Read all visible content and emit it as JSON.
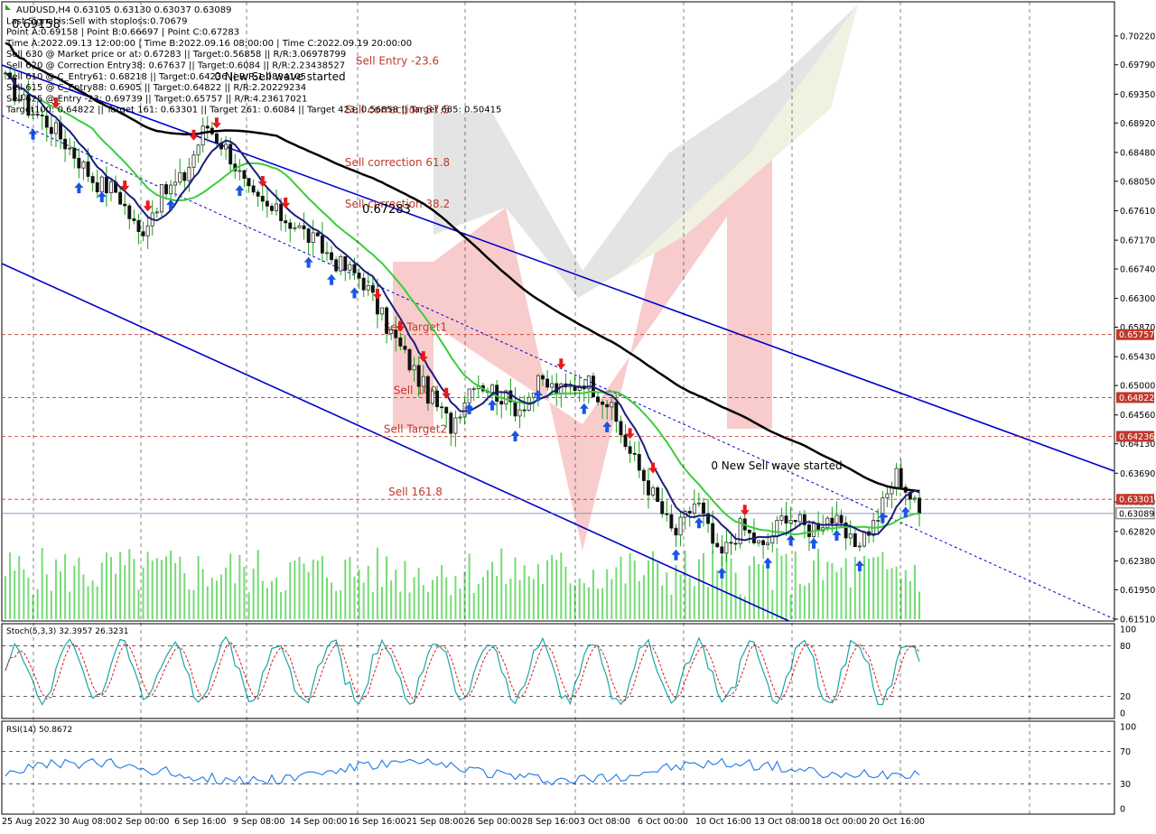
{
  "header": {
    "lines": [
      "AUDUSD,H4  0.63105 0.63130 0.63037 0.63089",
      "Last Signal is:Sell with stoploss:0.70679",
      "Point A:0.69158 | Point B:0.66697 | Point C:0.67283",
      "Time A:2022.09.13 12:00:00 | Time B:2022.09.16 08:00:00 | Time C:2022.09.19 20:00:00",
      "Sell 630 @ Market price or at: 0.67283 || Target:0.56858 || R/R:3.06978799",
      "Sell 620 @ Correction Entry38: 0.67637 || Target:0.6084 || R/R:2.23438527",
      "Sell 610 @ C_Entry61: 0.68218 || Target:0.64236 || R/R:1.0894105",
      "Sell 615 @ C_Entry88: 0.6905 || Target:0.64822 || R/R:2.20229234",
      "Sell 625 @ Entry -23: 0.69739 || Target:0.65757 || R/R:4.23617021",
      "Target100: 0.64822 || Target 161: 0.63301 || Target 261: 0.6084 || Target 423: 0.56858 || Target 685: 0.50415"
    ]
  },
  "annotations": {
    "new_sell_wave": "0 New Sell wave started",
    "new_sell_wave_top": "0 New Sell wave started",
    "price_tag": "0.67283",
    "price_tag_top": "0.69158"
  },
  "levels": [
    {
      "label": "Sell Entry -23.6",
      "price": 0.6974
    },
    {
      "label": "Sell correction 87.5",
      "price": 0.6901
    },
    {
      "label": "Sell correction 61.8",
      "price": 0.6822
    },
    {
      "label": "Sell correction 38.2",
      "price": 0.676
    },
    {
      "label": "Sell Target1",
      "price": 0.6576,
      "tag": "0.65757"
    },
    {
      "label": "Sell 100",
      "price": 0.6482,
      "tag": "0.64822"
    },
    {
      "label": "Sell Target2",
      "price": 0.6424,
      "tag": "0.64236"
    },
    {
      "label": "Sell 161.8",
      "price": 0.633,
      "tag": "0.63301"
    }
  ],
  "current_price": {
    "value": 0.63089,
    "label": "0.63089"
  },
  "indicators": {
    "stoch": {
      "label": "Stoch(5,3,3) 32.3957 26.3231",
      "ticks": [
        "100",
        "80",
        "20",
        "0"
      ],
      "tick_values": [
        100,
        80,
        20,
        0
      ]
    },
    "rsi": {
      "label": "RSI(14) 50.8672",
      "ticks": [
        "100",
        "70",
        "30",
        "0"
      ],
      "tick_values": [
        100,
        70,
        30,
        0
      ]
    }
  },
  "colors": {
    "bull": "#1b9e1b",
    "bear": "#1b9e1b",
    "ma_fast": "#1c1c7a",
    "ma_mid": "#3ccc3c",
    "ma_slow": "#000000",
    "channel": "#0000cc",
    "level": "#c0392b",
    "volume": "#3ccc3c",
    "stoch_main": "#1aa6a6",
    "stoch_signal": "#d62020",
    "rsi": "#1e78e8",
    "buy_arrow": "#1a55e6",
    "sell_arrow": "#e61a1a"
  },
  "chart_data": {
    "type": "candlestick",
    "symbol": "AUDUSD",
    "timeframe": "H4",
    "ohlc_last": {
      "open": 0.63105,
      "high": 0.6313,
      "low": 0.63037,
      "close": 0.63089
    },
    "ylim": [
      0.6151,
      0.7042
    ],
    "y_ticks": [
      0.7022,
      0.6979,
      0.6935,
      0.6892,
      0.6848,
      0.6805,
      0.6761,
      0.6717,
      0.6674,
      0.663,
      0.6587,
      0.6543,
      0.65,
      0.6456,
      0.6413,
      0.6369,
      0.6326,
      0.6282,
      0.6238,
      0.6195,
      0.6151
    ],
    "y_tick_labels": [
      "0.70220",
      "0.69790",
      "0.69350",
      "0.68920",
      "0.68480",
      "0.68050",
      "0.67610",
      "0.67170",
      "0.66740",
      "0.66300",
      "0.65870",
      "0.65430",
      "0.65000",
      "0.64560",
      "0.64130",
      "0.63690",
      "0.63260",
      "0.62820",
      "0.62380",
      "0.61950",
      "0.61510"
    ],
    "x_labels": [
      "25 Aug 2022",
      "30 Aug 08:00",
      "2 Sep 00:00",
      "6 Sep 16:00",
      "9 Sep 08:00",
      "14 Sep 00:00",
      "16 Sep 16:00",
      "21 Sep 08:00",
      "26 Sep 00:00",
      "28 Sep 16:00",
      "3 Oct 08:00",
      "6 Oct 00:00",
      "10 Oct 16:00",
      "13 Oct 08:00",
      "18 Oct 00:00",
      "20 Oct 16:00"
    ],
    "close_path": [
      [
        0,
        0.6955
      ],
      [
        1,
        0.6915
      ],
      [
        2,
        0.689
      ],
      [
        3,
        0.685
      ],
      [
        4,
        0.6805
      ],
      [
        5,
        0.679
      ],
      [
        6,
        0.6725
      ],
      [
        7,
        0.6785
      ],
      [
        8,
        0.681
      ],
      [
        9,
        0.689
      ],
      [
        10,
        0.685
      ],
      [
        11,
        0.678
      ],
      [
        12,
        0.676
      ],
      [
        13,
        0.674
      ],
      [
        14,
        0.671
      ],
      [
        15,
        0.668
      ],
      [
        16,
        0.666
      ],
      [
        17,
        0.6595
      ],
      [
        18,
        0.654
      ],
      [
        19,
        0.6485
      ],
      [
        20,
        0.644
      ],
      [
        21,
        0.651
      ],
      [
        22,
        0.649
      ],
      [
        23,
        0.6465
      ],
      [
        24,
        0.6505
      ],
      [
        25,
        0.649
      ],
      [
        26,
        0.651
      ],
      [
        27,
        0.6475
      ],
      [
        28,
        0.64
      ],
      [
        29,
        0.634
      ],
      [
        30,
        0.6275
      ],
      [
        31,
        0.633
      ],
      [
        32,
        0.624
      ],
      [
        33,
        0.629
      ],
      [
        34,
        0.6255
      ],
      [
        35,
        0.631
      ],
      [
        36,
        0.6285
      ],
      [
        37,
        0.6305
      ],
      [
        38,
        0.626
      ],
      [
        39,
        0.6295
      ],
      [
        40,
        0.637
      ],
      [
        41,
        0.6309
      ]
    ]
  }
}
